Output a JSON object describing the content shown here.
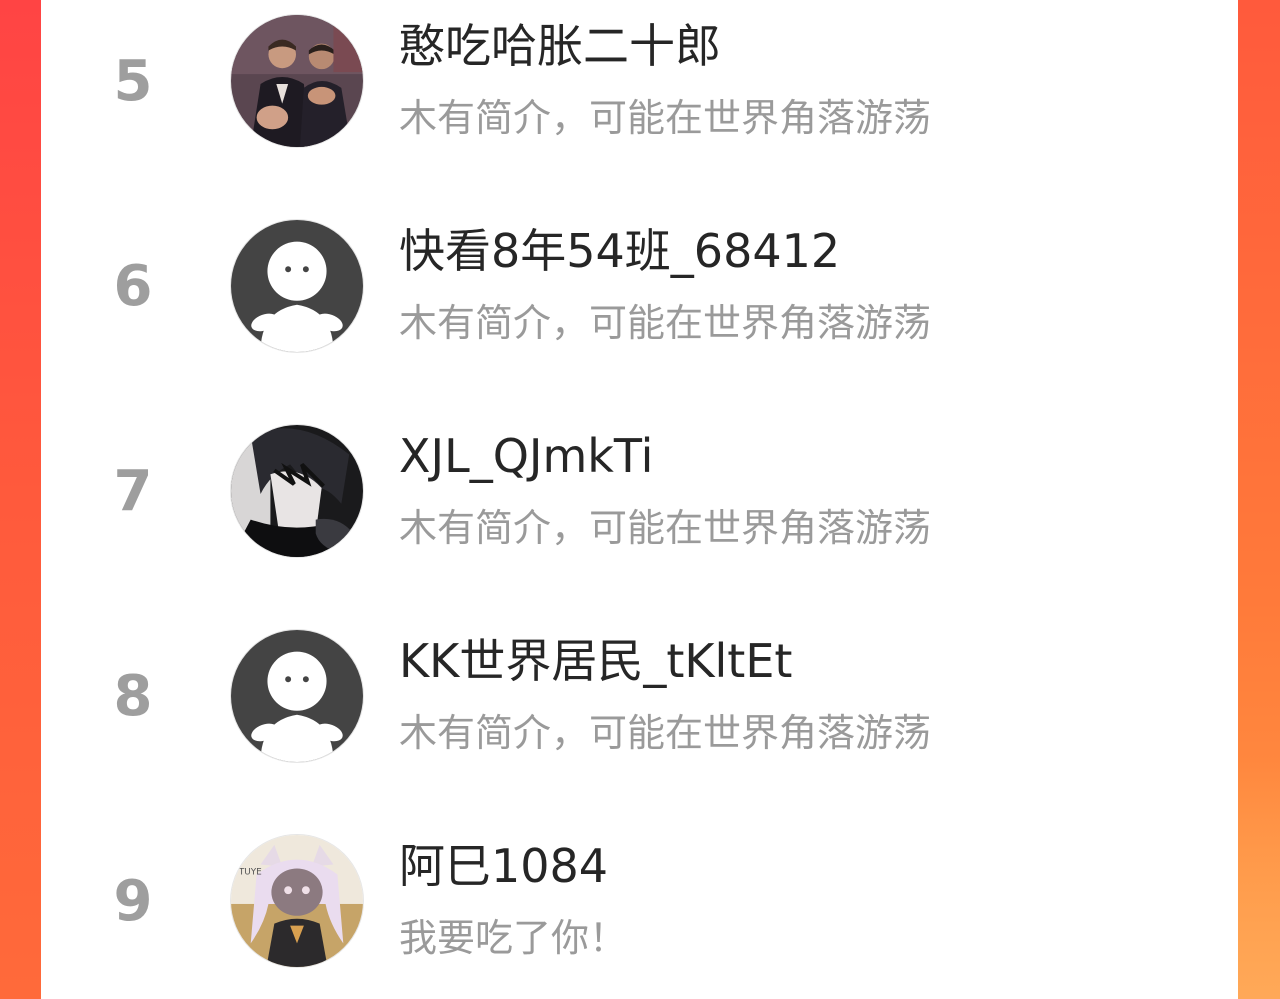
{
  "colors": {
    "brand_gradient_top": "#ff4b3e",
    "brand_gradient_bottom": "#ff8a3c",
    "rank_gray": "#9e9e9e",
    "name_text": "#262626",
    "bio_text": "#9a9a9a",
    "panel_bg": "#ffffff"
  },
  "ranking_list": [
    {
      "rank": "5",
      "name": "憨吃哈胀二十郎",
      "bio": "木有简介，可能在世界角落游荡",
      "avatar": "photo-avatar"
    },
    {
      "rank": "6",
      "name": "快看8年54班_68412",
      "bio": "木有简介，可能在世界角落游荡",
      "avatar": "default-avatar-icon"
    },
    {
      "rank": "7",
      "name": "XJL_QJmkTi",
      "bio": "木有简介，可能在世界角落游荡",
      "avatar": "anime-avatar"
    },
    {
      "rank": "8",
      "name": "KK世界居民_tKltEt",
      "bio": "木有简介，可能在世界角落游荡",
      "avatar": "default-avatar-icon"
    },
    {
      "rank": "9",
      "name": "阿巳1084",
      "bio": "我要吃了你！",
      "avatar": "illustration-avatar"
    }
  ]
}
